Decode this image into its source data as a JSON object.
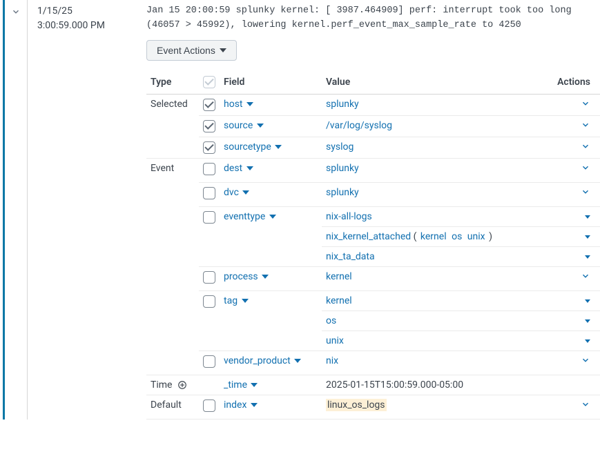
{
  "timestamp": {
    "date": "1/15/25",
    "time": "3:00:59.000 PM"
  },
  "raw_event": "Jan 15 20:00:59 splunky kernel: [ 3987.464909] perf: interrupt took too long (46057 > 45992), lowering kernel.perf_event_max_sample_rate to 4250",
  "event_actions_label": "Event Actions",
  "headers": {
    "type": "Type",
    "field": "Field",
    "value": "Value",
    "actions": "Actions"
  },
  "sections": {
    "selected": {
      "label": "Selected",
      "rows": [
        {
          "field": "host",
          "value": "splunky",
          "checked": true,
          "action_style": "chevron"
        },
        {
          "field": "source",
          "value": "/var/log/syslog",
          "checked": true,
          "action_style": "chevron"
        },
        {
          "field": "sourcetype",
          "value": "syslog",
          "checked": true,
          "action_style": "chevron"
        }
      ]
    },
    "event": {
      "label": "Event",
      "rows": [
        {
          "field": "dest",
          "checked": false,
          "values": [
            {
              "text": "splunky",
              "action_style": "chevron"
            }
          ]
        },
        {
          "field": "dvc",
          "checked": false,
          "values": [
            {
              "text": "splunky",
              "action_style": "chevron"
            }
          ]
        },
        {
          "field": "eventtype",
          "checked": false,
          "values": [
            {
              "text": "nix-all-logs",
              "action_style": "caret"
            },
            {
              "text": "nix_kernel_attached",
              "tags": [
                "kernel",
                "os",
                "unix"
              ],
              "action_style": "caret"
            },
            {
              "text": "nix_ta_data",
              "action_style": "caret"
            }
          ]
        },
        {
          "field": "process",
          "checked": false,
          "values": [
            {
              "text": "kernel",
              "action_style": "chevron"
            }
          ]
        },
        {
          "field": "tag",
          "checked": false,
          "values": [
            {
              "text": "kernel",
              "action_style": "caret"
            },
            {
              "text": "os",
              "action_style": "caret"
            },
            {
              "text": "unix",
              "action_style": "caret"
            }
          ]
        },
        {
          "field": "vendor_product",
          "checked": false,
          "values": [
            {
              "text": "nix",
              "action_style": "chevron"
            }
          ]
        }
      ]
    },
    "time": {
      "label": "Time",
      "rows": [
        {
          "field": "_time",
          "value_plain": "2025-01-15T15:00:59.000-05:00"
        }
      ]
    },
    "default": {
      "label": "Default",
      "rows": [
        {
          "field": "index",
          "checked": false,
          "value_hl": "linux_os_logs",
          "action_style": "chevron"
        }
      ]
    }
  }
}
